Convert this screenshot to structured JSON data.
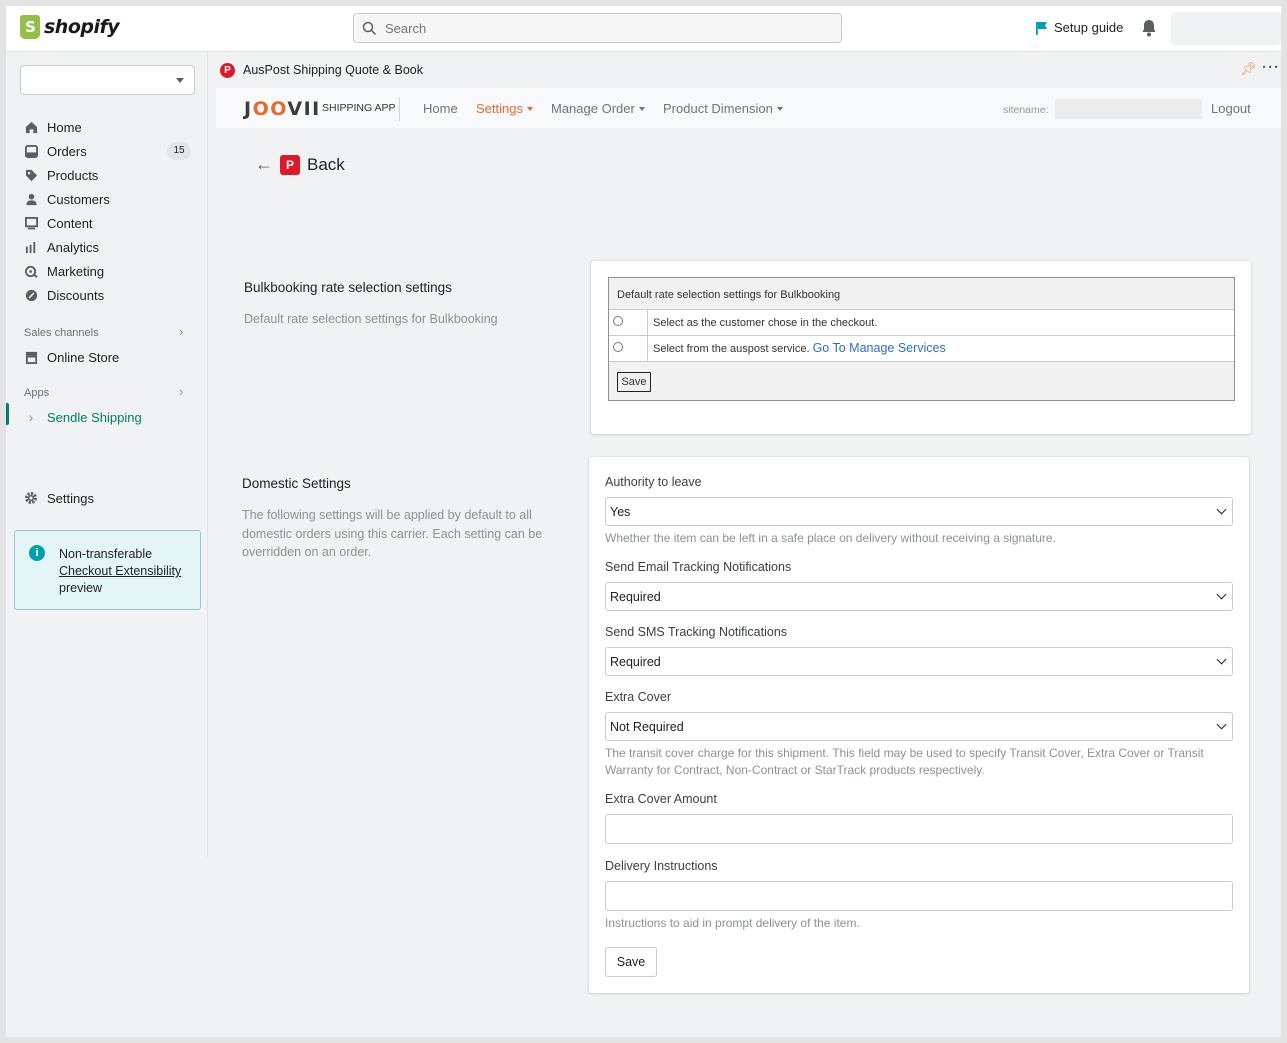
{
  "topbar": {
    "logo_text": "shopify",
    "search_placeholder": "Search",
    "setup_guide": "Setup guide"
  },
  "sidebar": {
    "nav": [
      {
        "label": "Home",
        "icon": "home-icon"
      },
      {
        "label": "Orders",
        "icon": "orders-icon",
        "badge": "15"
      },
      {
        "label": "Products",
        "icon": "tag-icon"
      },
      {
        "label": "Customers",
        "icon": "person-icon"
      },
      {
        "label": "Content",
        "icon": "content-icon"
      },
      {
        "label": "Analytics",
        "icon": "analytics-icon"
      },
      {
        "label": "Marketing",
        "icon": "marketing-icon"
      },
      {
        "label": "Discounts",
        "icon": "discount-icon"
      }
    ],
    "sales_channels_label": "Sales channels",
    "online_store": "Online Store",
    "apps_label": "Apps",
    "sendle": "Sendle Shipping",
    "settings": "Settings",
    "notice": {
      "line1": "Non-transferable",
      "link": "Checkout Extensibility",
      "line3": "preview"
    }
  },
  "app": {
    "title": "AusPost Shipping Quote & Book",
    "brand": "JOOVII",
    "brand_sub": "SHIPPING APP",
    "nav": {
      "home": "Home",
      "settings": "Settings",
      "manage_order": "Manage Order",
      "product_dimension": "Product Dimension"
    },
    "sitename_label": "sitename:",
    "logout": "Logout",
    "back": "Back"
  },
  "bulk": {
    "title": "Bulkbooking rate selection settings",
    "desc": "Default rate selection settings for Bulkbooking",
    "table_header": "Default rate selection settings for Bulkbooking",
    "option1": "Select as the customer chose in the checkout.",
    "option2": "Select from the auspost service.",
    "option2_link": "Go To Manage Services",
    "save": "Save"
  },
  "domestic": {
    "title": "Domestic Settings",
    "desc": "The following settings will be applied by default to all domestic orders using this carrier. Each setting can be overridden on an order.",
    "authority_label": "Authority to leave",
    "authority_value": "Yes",
    "authority_help": "Whether the item can be left in a safe place on delivery without receiving a signature.",
    "email_label": "Send Email Tracking Notifications",
    "email_value": "Required",
    "sms_label": "Send SMS Tracking Notifications",
    "sms_value": "Required",
    "extra_cover_label": "Extra Cover",
    "extra_cover_value": "Not Required",
    "extra_cover_help": "The transit cover charge for this shipment. This field may be used to specify Transit Cover, Extra Cover or Transit Warranty for Contract, Non-Contract or StarTrack products respectively.",
    "extra_cover_amount_label": "Extra Cover Amount",
    "extra_cover_amount_value": "",
    "delivery_label": "Delivery Instructions",
    "delivery_value": "",
    "delivery_help": "Instructions to aid in prompt delivery of the item.",
    "save": "Save"
  }
}
